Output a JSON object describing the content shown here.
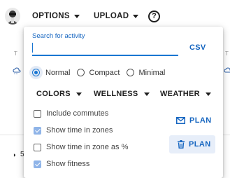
{
  "header": {
    "options_label": "OPTIONS",
    "upload_label": "UPLOAD",
    "help_glyph": "?"
  },
  "background": {
    "edge_left_glyph": "T",
    "edge_right_glyph": "T",
    "moon_glyph": "◗",
    "day_value": "5"
  },
  "panel": {
    "search": {
      "label": "Search for activity",
      "value": "",
      "placeholder": ""
    },
    "csv_label": "CSV",
    "density": {
      "options": [
        "Normal",
        "Compact",
        "Minimal"
      ],
      "selected": "Normal"
    },
    "dropdowns": {
      "colors": "COLORS",
      "wellness": "WELLNESS",
      "weather": "WEATHER"
    },
    "checkboxes": [
      {
        "label": "Include commutes",
        "checked": false
      },
      {
        "label": "Show time in zones",
        "checked": true
      },
      {
        "label": "Show time in zone as %",
        "checked": false
      },
      {
        "label": "Show fitness",
        "checked": true
      }
    ],
    "plan_buttons": [
      {
        "label": "PLAN",
        "icon": "mail-icon"
      },
      {
        "label": "PLAN",
        "icon": "trash-icon"
      }
    ]
  },
  "colors": {
    "accent": "#1976d2",
    "accent_text": "#1565c0",
    "checked_box": "#8fb4e8",
    "plan_highlight": "#e7eef9"
  }
}
